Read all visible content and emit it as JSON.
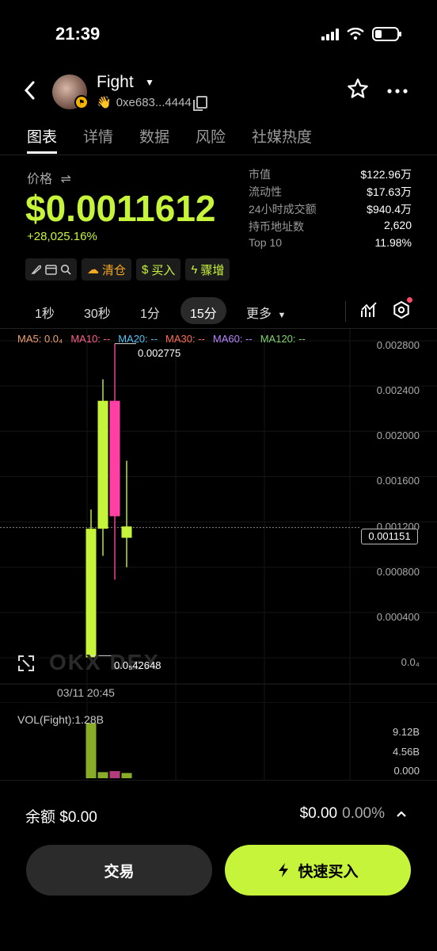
{
  "status_bar": {
    "time": "21:39"
  },
  "header": {
    "token_name": "Fight",
    "address": "0xe683...4444",
    "address_emoji": "👋"
  },
  "tabs": [
    {
      "label": "图表",
      "active": true
    },
    {
      "label": "详情",
      "active": false
    },
    {
      "label": "数据",
      "active": false
    },
    {
      "label": "风险",
      "active": false
    },
    {
      "label": "社媒热度",
      "active": false
    }
  ],
  "price": {
    "label": "价格",
    "swap_glyph": "⇌",
    "value": "$0.0011612",
    "change": "+28,025.16%"
  },
  "stats": [
    {
      "key": "市值",
      "value": "$122.96万"
    },
    {
      "key": "流动性",
      "value": "$17.63万"
    },
    {
      "key": "24小时成交额",
      "value": "$940.4万"
    },
    {
      "key": "持币地址数",
      "value": "2,620"
    },
    {
      "key": "Top 10",
      "value": "11.98%"
    }
  ],
  "chips": {
    "clear": "清仓",
    "buy": "买入",
    "surge": "骤增"
  },
  "timeframes": {
    "t1": "1秒",
    "t2": "30秒",
    "t3": "1分",
    "t4": "15分",
    "more": "更多",
    "active": "15分"
  },
  "ma": [
    {
      "label": "MA5: 0.0₄",
      "color": "#f0a070"
    },
    {
      "label": "MA10: --",
      "color": "#ff5f8a"
    },
    {
      "label": "MA20: --",
      "color": "#4fc3f7"
    },
    {
      "label": "MA30: --",
      "color": "#ff6b57"
    },
    {
      "label": "MA60: --",
      "color": "#b884ff"
    },
    {
      "label": "MA120: --",
      "color": "#7fd36b"
    }
  ],
  "chart_data": {
    "type": "candlestick",
    "yaxis_ticks": [
      "0.002800",
      "0.002400",
      "0.002000",
      "0.001600",
      "0.001200",
      "0.000800",
      "0.000400",
      "0.0₄"
    ],
    "ylim": [
      0,
      0.0028
    ],
    "current_price_tag": "0.001151",
    "high_label": "0.002775",
    "low_label": "0.0₅42648",
    "x_label": "03/11 20:45",
    "candles": [
      {
        "open": 4.3e-06,
        "close": 0.00114,
        "high": 0.00131,
        "low": 4.3e-06,
        "color": "#c6f43a"
      },
      {
        "open": 0.00114,
        "close": 0.00227,
        "high": 0.00246,
        "low": 0.0009,
        "color": "#c6f43a"
      },
      {
        "open": 0.00227,
        "close": 0.00125,
        "high": 0.002775,
        "low": 0.00069,
        "color": "#ff3fa4"
      },
      {
        "open": 0.00106,
        "close": 0.00116,
        "high": 0.00174,
        "low": 0.0008,
        "color": "#c6f43a"
      }
    ],
    "volume": {
      "label": "VOL(Fight):1.28B",
      "ticks": [
        "9.12B",
        "4.56B",
        "0.000"
      ],
      "ylim": [
        0,
        12000000000
      ],
      "values": [
        11600000000,
        1280000000,
        1500000000,
        1100000000
      ],
      "colors": [
        "#88ab28",
        "#88ab28",
        "#b33d7c",
        "#88ab28"
      ]
    }
  },
  "watermark": "OKX DEX",
  "bottom": {
    "balance": "余额 $0.00",
    "amount": "$0.00",
    "percent": "0.00%",
    "trade_btn": "交易",
    "buy_btn": "快速买入"
  }
}
